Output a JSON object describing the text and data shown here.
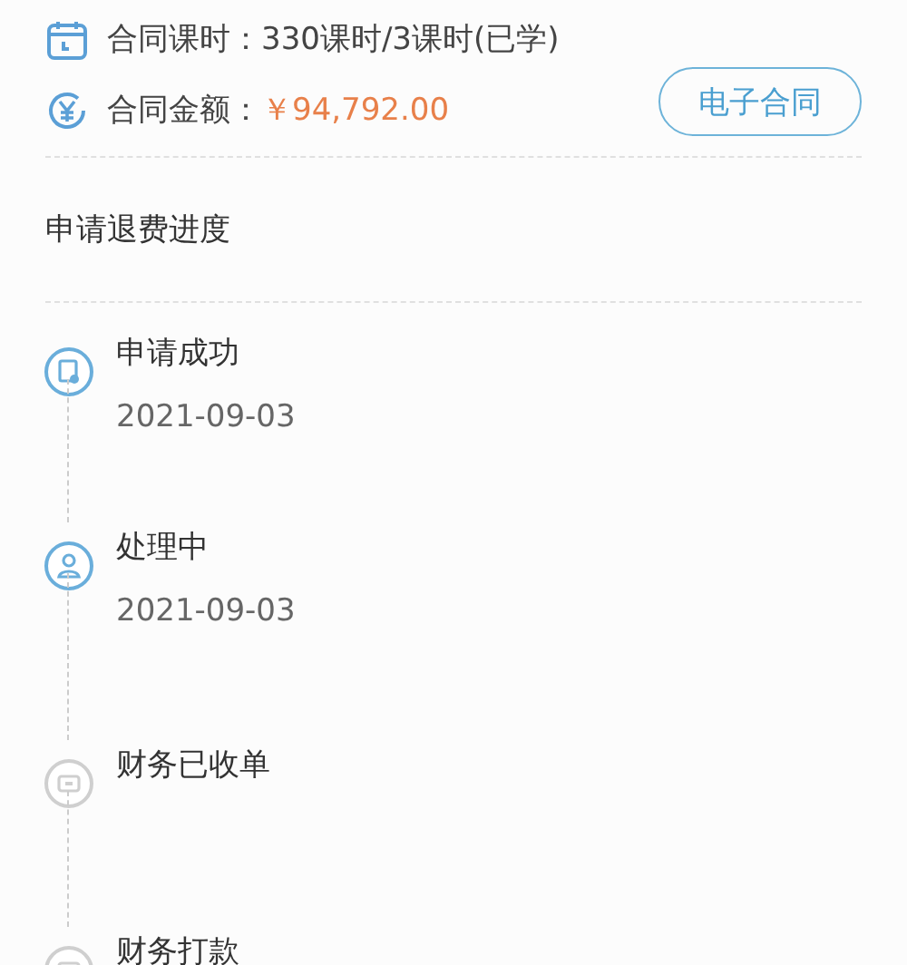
{
  "contract": {
    "hours_label": "合同课时：",
    "hours_value": "330课时/3课时(已学)",
    "amount_label": "合同金额：",
    "amount_value": "￥94,792.00",
    "button": "电子合同"
  },
  "progress": {
    "title": "申请退费进度",
    "steps": [
      {
        "kind": "form",
        "title": "申请成功",
        "date": "2021-09-03",
        "active": true
      },
      {
        "kind": "person",
        "title": "处理中",
        "date": "2021-09-03",
        "active": true
      },
      {
        "kind": "card",
        "title": "财务已收单",
        "active": false
      },
      {
        "kind": "card",
        "title": "财务打款",
        "active": false
      }
    ]
  }
}
